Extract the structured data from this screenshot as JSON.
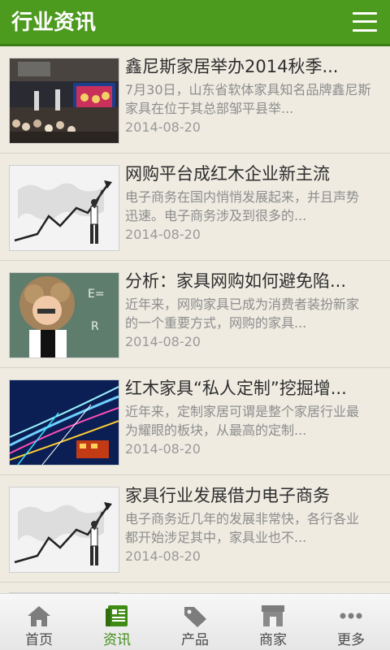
{
  "header": {
    "title": "行业资讯",
    "menu_icon": "menu-icon"
  },
  "articles": [
    {
      "title": "鑫尼斯家居举办2014秋季...",
      "desc": "7月30日，山东省软体家具知名品牌鑫尼斯家具在位于其总部邹平县举...",
      "date": "2014-08-20",
      "image": "event-stage-photo"
    },
    {
      "title": "网购平台成红木企业新主流",
      "desc": "电子商务在国内悄悄发展起来，并且声势迅速。电子商务涉及到很多的...",
      "date": "2014-08-20",
      "image": "growth-chart-businessman"
    },
    {
      "title": "分析：家具网购如何避免陷...",
      "desc": "近年来，网购家具已成为消费者装扮新家的一个重要方式，网购的家具...",
      "date": "2014-08-20",
      "image": "curly-hair-child-blackboard"
    },
    {
      "title": "红木家具“私人定制”挖掘增...",
      "desc": "近年来，定制家居可谓是整个家居行业最为耀眼的板块，从最高的定制...",
      "date": "2014-08-20",
      "image": "light-trails-city"
    },
    {
      "title": "家具行业发展借力电子商务",
      "desc": "电子商务近几年的发展非常快，各行各业都开始涉足其中，家具业也不...",
      "date": "2014-08-20",
      "image": "growth-chart-businessman"
    }
  ],
  "tabbar": {
    "active_color": "#3f8c15",
    "items": [
      {
        "label": "首页",
        "icon": "home-icon"
      },
      {
        "label": "资讯",
        "icon": "news-icon",
        "active": true
      },
      {
        "label": "产品",
        "icon": "tag-icon"
      },
      {
        "label": "商家",
        "icon": "store-icon"
      },
      {
        "label": "更多",
        "icon": "more-icon"
      }
    ]
  },
  "colors": {
    "header": "#4c9a1e",
    "background": "#efebe1"
  }
}
